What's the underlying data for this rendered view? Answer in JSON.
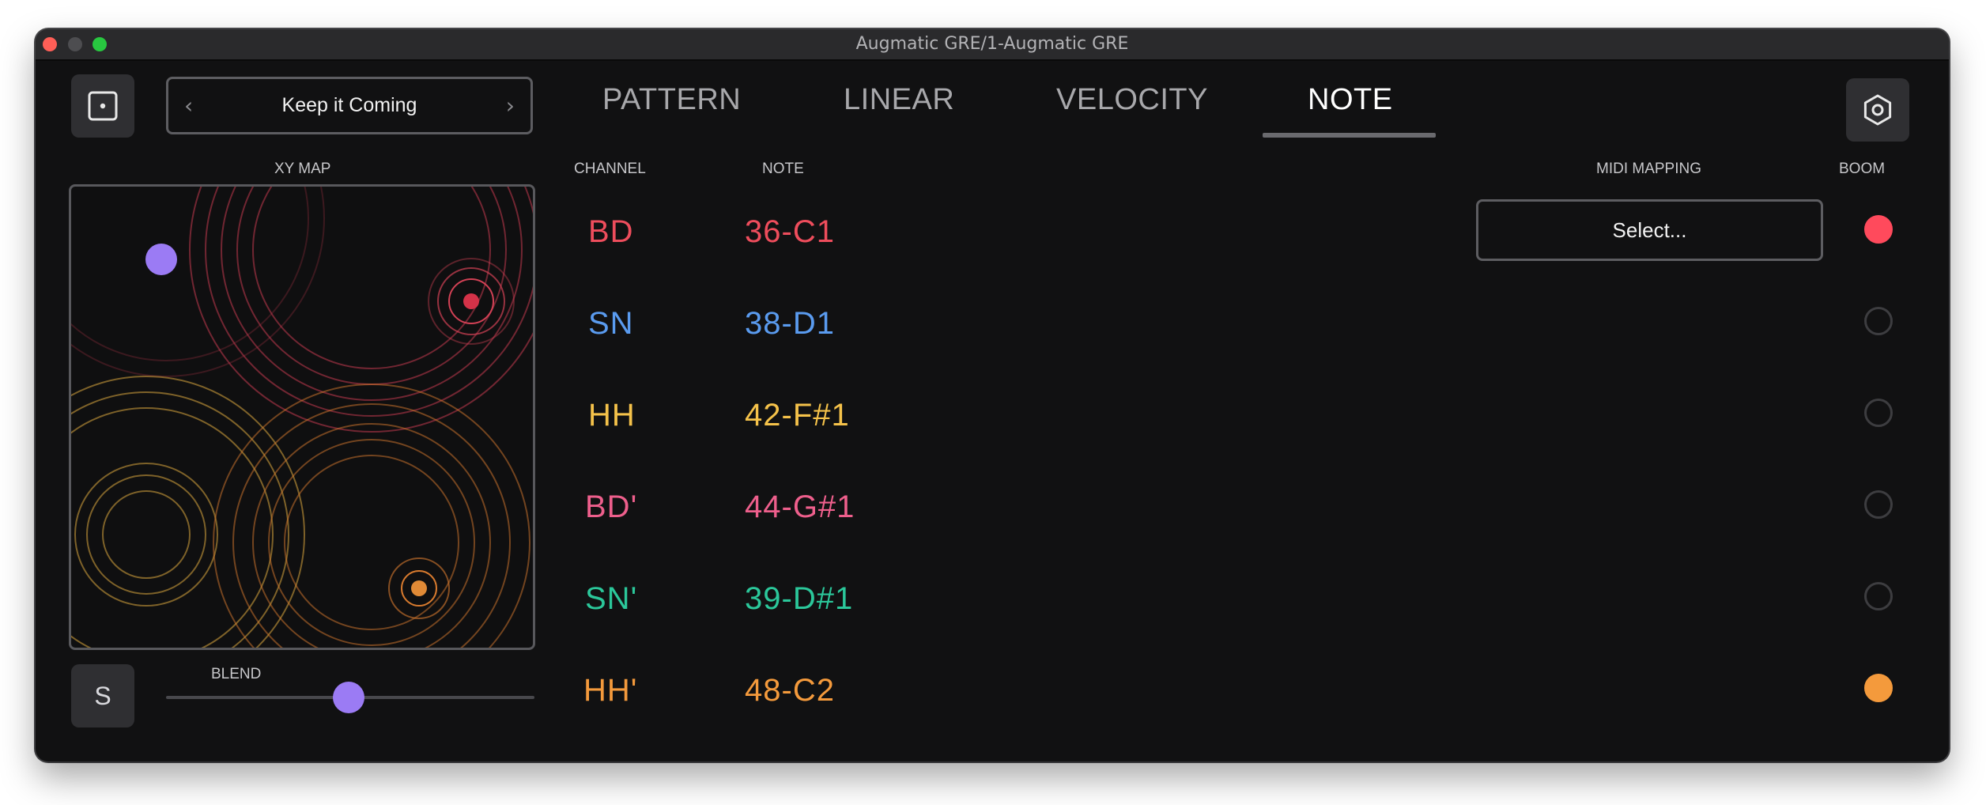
{
  "window": {
    "title": "Augmatic GRE/1-Augmatic GRE"
  },
  "preset": {
    "name": "Keep it Coming",
    "prev_glyph": "‹",
    "next_glyph": "›"
  },
  "tabs": [
    {
      "label": "PATTERN",
      "active": false
    },
    {
      "label": "LINEAR",
      "active": false
    },
    {
      "label": "VELOCITY",
      "active": false
    },
    {
      "label": "NOTE",
      "active": true
    }
  ],
  "icons": {
    "randomize": "dice-icon",
    "settings": "gear-icon"
  },
  "xymap": {
    "label": "XY MAP",
    "accent": "#9b7bf4"
  },
  "solo_button": {
    "label": "S"
  },
  "blend": {
    "label": "BLEND",
    "value": 0.5
  },
  "columns": {
    "channel": "CHANNEL",
    "note": "NOTE",
    "midi_mapping": "MIDI MAPPING",
    "boom": "BOOM"
  },
  "rows": [
    {
      "channel": "BD",
      "note": "36-C1",
      "color": "#ee4d5c",
      "boom": true,
      "boom_color": "#ff4a5c"
    },
    {
      "channel": "SN",
      "note": "38-D1",
      "color": "#5a9bef",
      "boom": false
    },
    {
      "channel": "HH",
      "note": "42-F#1",
      "color": "#f5c24a",
      "boom": false
    },
    {
      "channel": "BD'",
      "note": "44-G#1",
      "color": "#ee5f8c",
      "boom": false
    },
    {
      "channel": "SN'",
      "note": "39-D#1",
      "color": "#2bc79a",
      "boom": false
    },
    {
      "channel": "HH'",
      "note": "48-C2",
      "color": "#f49a3c",
      "boom": true,
      "boom_color": "#f49a3c"
    }
  ],
  "midi_mapping": {
    "select_label": "Select..."
  }
}
